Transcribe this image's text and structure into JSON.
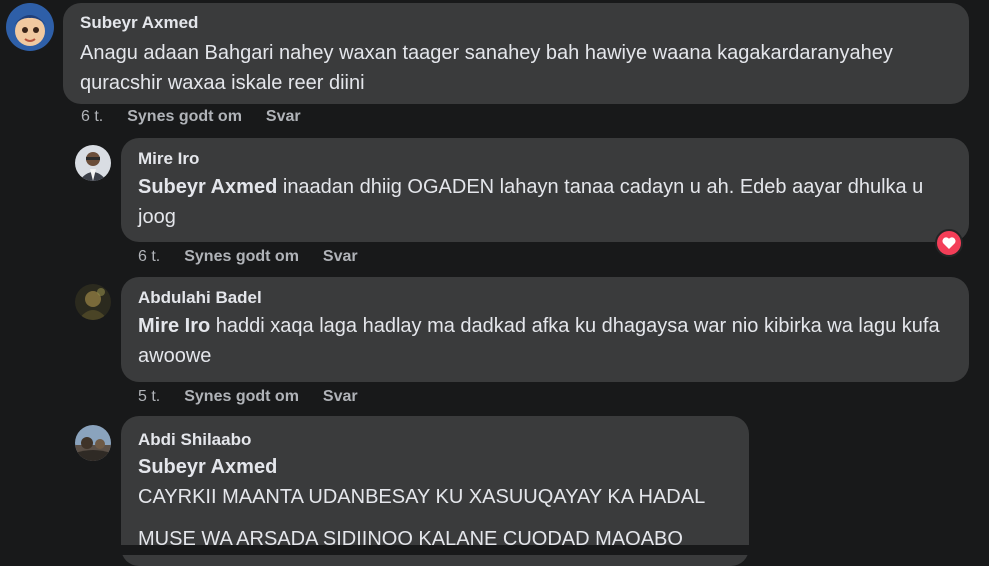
{
  "comments": [
    {
      "author": "Subeyr Axmed",
      "text": "Anagu adaan Bahgari nahey waxan taager sanahey bah hawiye waana kagakardaranyahey quracshir waxaa iskale reer diini",
      "time": "6 t.",
      "like_label": "Synes godt om",
      "reply_label": "Svar"
    },
    {
      "author": "Mire Iro",
      "mention": "Subeyr Axmed",
      "text": " inaadan dhiig OGADEN lahayn tanaa cadayn u ah. Edeb aayar dhulka u joog",
      "time": "6 t.",
      "like_label": "Synes godt om",
      "reply_label": "Svar",
      "reaction_icon": "heart-icon"
    },
    {
      "author": "Abdulahi Badel",
      "mention": "Mire Iro",
      "text": " haddi xaqa laga hadlay ma dadkad afka ku dhagaysa war nio kibirka wa lagu kufa awoowe",
      "time": "5 t.",
      "like_label": "Synes godt om",
      "reply_label": "Svar"
    },
    {
      "author": "Abdi Shilaabo",
      "mention": "Subeyr Axmed",
      "line1": "CAYRKII MAANTA UDANBESAY KU XASUUQAYAY KA HADAL",
      "line2": "MUSE WA ARSADA SIDIINOO KALANE CUQDAD MAQABO"
    }
  ],
  "colors": {
    "background": "#18191a",
    "bubble": "#3a3b3c",
    "text": "#e4e6eb",
    "muted": "#b0b3b8",
    "heart": "#f33e58"
  }
}
